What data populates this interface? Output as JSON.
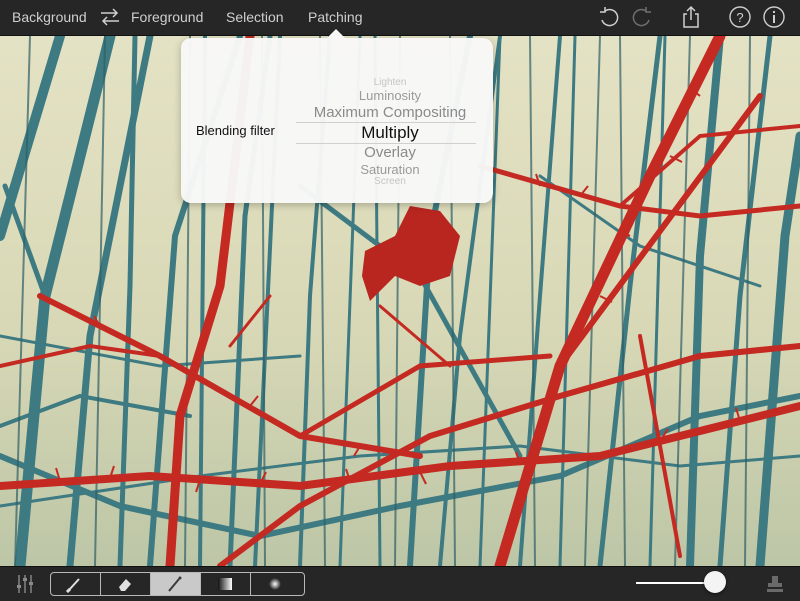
{
  "nav": {
    "background": "Background",
    "foreground": "Foreground",
    "selection": "Selection",
    "patching": "Patching"
  },
  "toolbar_icons": [
    "undo-icon",
    "redo-icon",
    "share-icon",
    "help-icon",
    "info-icon"
  ],
  "popover": {
    "label": "Blending filter",
    "options": [
      "Lighten",
      "Luminosity",
      "Maximum Compositing",
      "Multiply",
      "Overlay",
      "Saturation",
      "Screen"
    ],
    "selected": "Multiply"
  },
  "bottom_tools": [
    "brush-icon",
    "eraser-icon",
    "magic-wand-icon",
    "gradient-icon",
    "radial-icon"
  ],
  "active_tool": "magic-wand-icon",
  "opacity_slider": 0.95,
  "colors": {
    "bar": "#262626",
    "text": "#cfcfcf",
    "thorns": "#c42a22",
    "trees": "#3e7a82",
    "sky": "#e4e2c4"
  }
}
